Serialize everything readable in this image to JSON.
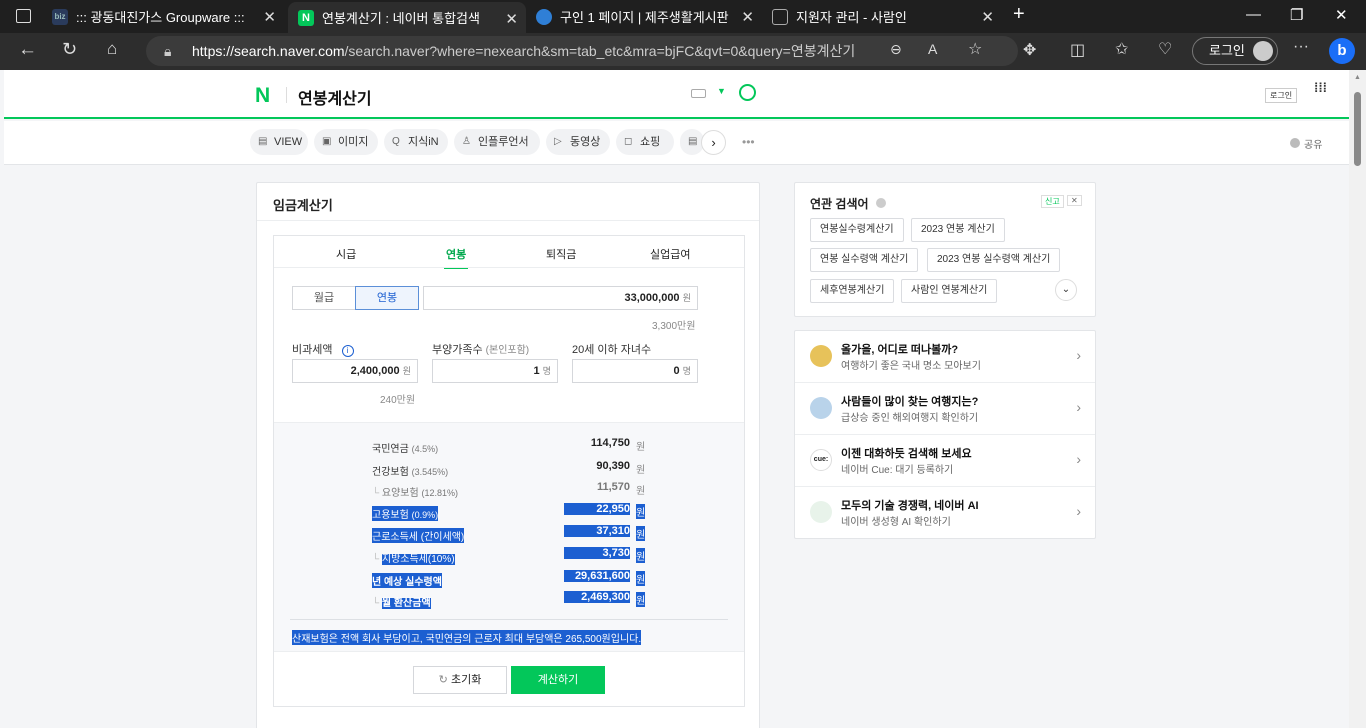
{
  "tabs": [
    {
      "title": "::: 광동대진가스 Groupware :::",
      "favicon": "biz"
    },
    {
      "title": "연봉계산기 : 네이버 통합검색",
      "favicon": "N"
    },
    {
      "title": "구인 1 페이지 | 제주생활게시판",
      "favicon": ""
    },
    {
      "title": "지원자 관리 - 사람인",
      "favicon": ""
    }
  ],
  "address": {
    "host": "https://search.naver.com",
    "path": "/search.naver?where=nexearch&sm=tab_etc&mra=bjFC&qvt=0&query=연봉계산기",
    "login": "로그인"
  },
  "naver": {
    "logo": "N",
    "query": "연봉계산기",
    "login_small": "로그인",
    "nav": [
      "VIEW",
      "이미지",
      "지식iN",
      "인플루언서",
      "동영상",
      "쇼핑"
    ],
    "share": "공유"
  },
  "calc": {
    "title": "임금계산기",
    "tabs": [
      "시급",
      "연봉",
      "퇴직금",
      "실업급여"
    ],
    "toggle": [
      "월급",
      "연봉"
    ],
    "salary": "33,000,000",
    "unit": "원",
    "salary_hint": "3,300만원",
    "nontax_label": "비과세액",
    "dependents_label": "부양가족수",
    "dependents_note": "(본인포함)",
    "children_label": "20세 이하 자녀수",
    "nontax": "2,400,000",
    "nontax_hint": "240만원",
    "dependents": "1",
    "children": "0",
    "person_unit": "명",
    "rows": [
      {
        "label": "국민연금",
        "rate": "(4.5%)",
        "value": "114,750"
      },
      {
        "label": "건강보험",
        "rate": "(3.545%)",
        "value": "90,390"
      },
      {
        "label": "요양보험",
        "rate": "(12.81%)",
        "value": "11,570"
      },
      {
        "label": "고용보험",
        "rate": "(0.9%)",
        "value": "22,950"
      },
      {
        "label": "근로소득세",
        "rate": "(간이세액)",
        "value": "37,310"
      },
      {
        "label": "지방소득세",
        "rate": "(10%)",
        "value": "3,730"
      },
      {
        "label": "년 예상 실수령액",
        "rate": "",
        "value": "29,631,600"
      },
      {
        "label": "월 환산금액",
        "rate": "",
        "value": "2,469,300"
      }
    ],
    "note": "산재보험은 전액 회사 부담이고, 국민연금의 근로자 최대 부담액은 265,500원입니다.",
    "reset": "초기화",
    "calculate": "계산하기"
  },
  "related": {
    "title": "연관 검색어",
    "report": "신고",
    "chips": [
      "연봉실수령계산기",
      "2023 연봉 계산기",
      "연봉 실수령액 계산기",
      "2023 연봉 실수령액 계산기",
      "세후연봉계산기",
      "사람인 연봉계산기"
    ]
  },
  "suggestions": [
    {
      "title": "올가을, 어디로 떠나볼까?",
      "sub": "여행하기 좋은 국내 명소 모아보기",
      "color": "#e7c25a"
    },
    {
      "title": "사람들이 많이 찾는 여행지는?",
      "sub": "급상승 중인 해외여행지 확인하기",
      "color": "#b9d3ea"
    },
    {
      "title": "이젠 대화하듯 검색해 보세요",
      "sub": "네이버 Cue: 대기 등록하기",
      "color": "#ffffff"
    },
    {
      "title": "모두의 기술 경쟁력, 네이버 AI",
      "sub": "네이버 생성형 AI 확인하기",
      "color": "#e8f3ea"
    }
  ]
}
